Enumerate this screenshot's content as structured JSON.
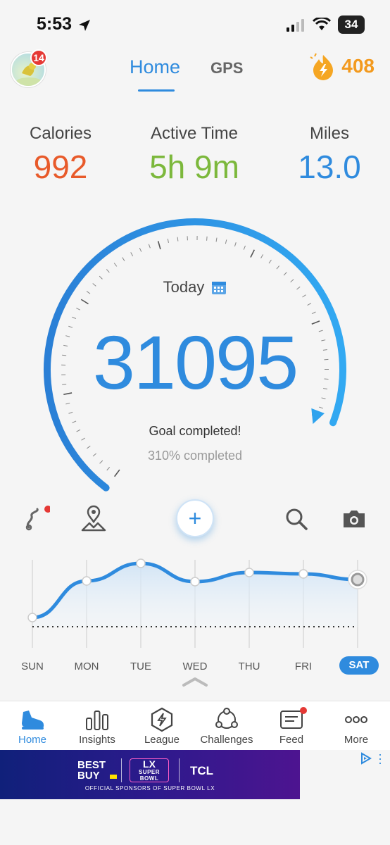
{
  "status": {
    "time": "5:53",
    "battery": "34"
  },
  "header": {
    "avatar_badge": "14",
    "tabs": [
      {
        "label": "Home"
      },
      {
        "label": "GPS"
      }
    ],
    "streak_value": "408"
  },
  "stats": [
    {
      "label": "Calories",
      "value": "992",
      "color": "#e85a2a"
    },
    {
      "label": "Active Time",
      "value": "5h 9m",
      "color": "#7cb83c"
    },
    {
      "label": "Miles",
      "value": "13.0",
      "color": "#2f8bde"
    }
  ],
  "gauge": {
    "day_label": "Today",
    "steps": "31095",
    "goal_status": "Goal completed!",
    "percent_text": "310% completed",
    "progress_fraction": 1.0,
    "accent": "#2f8bde"
  },
  "toolbar": {
    "icons": [
      "route-icon",
      "map-pin-icon",
      "add-icon",
      "search-icon",
      "camera-icon"
    ],
    "add_label": "+"
  },
  "week": {
    "days": [
      "SUN",
      "MON",
      "TUE",
      "WED",
      "THU",
      "FRI",
      "SAT"
    ],
    "selected": "SAT",
    "relative_values": [
      0.08,
      0.6,
      0.85,
      0.59,
      0.72,
      0.7,
      0.62
    ]
  },
  "nav": {
    "items": [
      {
        "label": "Home",
        "icon": "shoe-icon"
      },
      {
        "label": "Insights",
        "icon": "bar-chart-icon"
      },
      {
        "label": "League",
        "icon": "lightning-hexagon-icon"
      },
      {
        "label": "Challenges",
        "icon": "group-icon"
      },
      {
        "label": "Feed",
        "icon": "feed-icon"
      },
      {
        "label": "More",
        "icon": "more-icon"
      }
    ]
  },
  "ad": {
    "brand1": "BEST BUY",
    "event_top": "LX",
    "event_bottom": "SUPER BOWL",
    "brand2": "TCL",
    "footer": "OFFICIAL SPONSORS OF SUPER BOWL LX"
  }
}
